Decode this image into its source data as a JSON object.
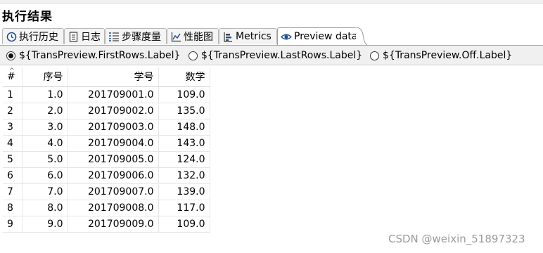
{
  "panel": {
    "title": "执行结果"
  },
  "tabs": [
    {
      "icon": "clock-icon",
      "label": "执行历史"
    },
    {
      "icon": "document-icon",
      "label": "日志"
    },
    {
      "icon": "list-steps-icon",
      "label": "步骤度量"
    },
    {
      "icon": "line-chart-icon",
      "label": "性能图"
    },
    {
      "icon": "metrics-icon",
      "label": "Metrics"
    },
    {
      "icon": "eye-icon",
      "label": "Preview data"
    }
  ],
  "active_tab": "Preview data",
  "preview_options": {
    "first_rows": "${TransPreview.FirstRows.Label}",
    "last_rows": "${TransPreview.LastRows.Label}",
    "off": "${TransPreview.Off.Label}",
    "selected": "first_rows"
  },
  "table": {
    "columns": [
      "#",
      "序号",
      "学号",
      "数学"
    ],
    "rows": [
      [
        "1",
        "1.0",
        "201709001.0",
        "109.0"
      ],
      [
        "2",
        "2.0",
        "201709002.0",
        "135.0"
      ],
      [
        "3",
        "3.0",
        "201709003.0",
        "148.0"
      ],
      [
        "4",
        "4.0",
        "201709004.0",
        "143.0"
      ],
      [
        "5",
        "5.0",
        "201709005.0",
        "124.0"
      ],
      [
        "6",
        "6.0",
        "201709006.0",
        "132.0"
      ],
      [
        "7",
        "7.0",
        "201709007.0",
        "139.0"
      ],
      [
        "8",
        "8.0",
        "201709008.0",
        "117.0"
      ],
      [
        "9",
        "9.0",
        "201709009.0",
        "109.0"
      ]
    ]
  },
  "watermark": "CSDN @weixin_51897323"
}
